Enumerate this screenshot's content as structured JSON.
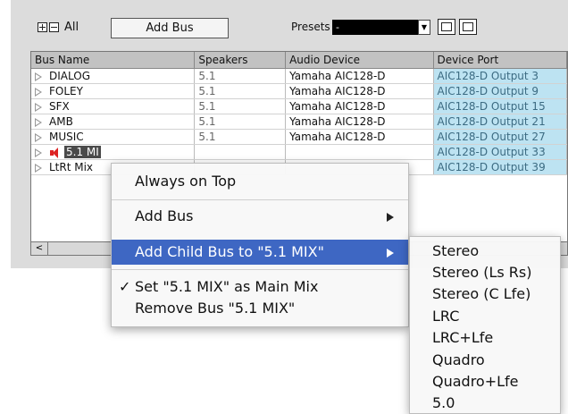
{
  "toolbar": {
    "all_label": "All",
    "add_bus_label": "Add Bus",
    "presets_label": "Presets",
    "presets_value": "-"
  },
  "table": {
    "columns": [
      "Bus Name",
      "Speakers",
      "Audio Device",
      "Device Port"
    ],
    "rows": [
      {
        "name": "DIALOG",
        "speakers": "5.1",
        "device": "Yamaha AIC128-D",
        "port": "AIC128-D Output 3"
      },
      {
        "name": "FOLEY",
        "speakers": "5.1",
        "device": "Yamaha AIC128-D",
        "port": "AIC128-D Output 9"
      },
      {
        "name": "SFX",
        "speakers": "5.1",
        "device": "Yamaha AIC128-D",
        "port": "AIC128-D Output 15"
      },
      {
        "name": "AMB",
        "speakers": "5.1",
        "device": "Yamaha AIC128-D",
        "port": "AIC128-D Output 21"
      },
      {
        "name": "MUSIC",
        "speakers": "5.1",
        "device": "Yamaha AIC128-D",
        "port": "AIC128-D Output 27"
      },
      {
        "name": "5.1 MI",
        "speakers": "",
        "device": "",
        "port": "AIC128-D Output 33"
      },
      {
        "name": "LtRt Mix",
        "speakers": "",
        "device": "",
        "port": "AIC128-D Output 39"
      }
    ]
  },
  "context_menu": {
    "always_on_top": "Always on Top",
    "add_bus": "Add Bus",
    "add_child_bus": "Add Child Bus to \"5.1 MIX\"",
    "set_main_mix": "Set \"5.1 MIX\" as Main Mix",
    "remove_bus": "Remove Bus \"5.1 MIX\"",
    "checkmark": "✓"
  },
  "submenu": {
    "items": [
      "Stereo",
      "Stereo (Ls Rs)",
      "Stereo (C Lfe)",
      "LRC",
      "LRC+Lfe",
      "Quadro",
      "Quadro+Lfe",
      "5.0"
    ]
  },
  "colors": {
    "menu_highlight": "#3e67c3",
    "port_cell": "#bde3f2",
    "speaker_icon": "#dd2222"
  }
}
